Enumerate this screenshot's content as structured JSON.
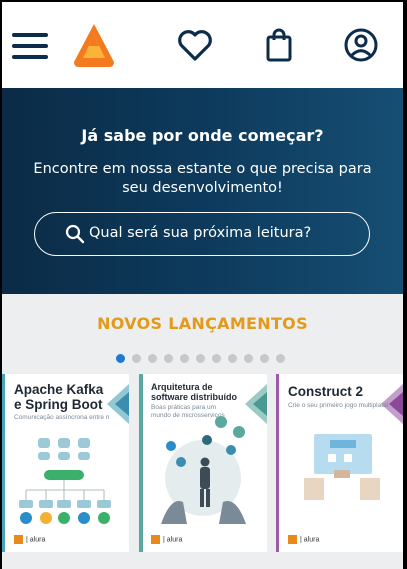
{
  "header": {
    "menu_icon": "hamburger-icon",
    "logo_icon": "casa-do-codigo-logo",
    "wishlist_icon": "heart-icon",
    "cart_icon": "shopping-bag-icon",
    "account_icon": "user-circle-icon"
  },
  "hero": {
    "title": "Já sabe por onde começar?",
    "subtitle": "Encontre em nossa estante o que precisa para seu desenvolvimento!",
    "search_placeholder": "Qual será sua próxima leitura?"
  },
  "releases": {
    "title": "NOVOS LANÇAMENTOS",
    "carousel_active_index": 0,
    "carousel_dot_count": 11,
    "books": [
      {
        "title_line1": "Apache Kafka",
        "title_line2": "e Spring Boot",
        "subtitle": "Comunicação assíncrona entre microsserviços",
        "accent": "#4aa3b8",
        "publisher": "alura"
      },
      {
        "title_line1": "Arquitetura de",
        "title_line2": "software distribuído",
        "subtitle": "Boas práticas para um mundo de microsserviços",
        "accent": "#5aa9a0",
        "publisher": "alura"
      },
      {
        "title_line1": "Construct 2",
        "title_line2": "",
        "subtitle": "Crie o seu primeiro jogo multiplataforma",
        "accent": "#9b5ba8",
        "publisher": "alura"
      }
    ]
  },
  "colors": {
    "hero_bg": "#0d3a5c",
    "brand_orange": "#f47a20",
    "section_title": "#e39a1a",
    "dot_active": "#1f78d1"
  }
}
